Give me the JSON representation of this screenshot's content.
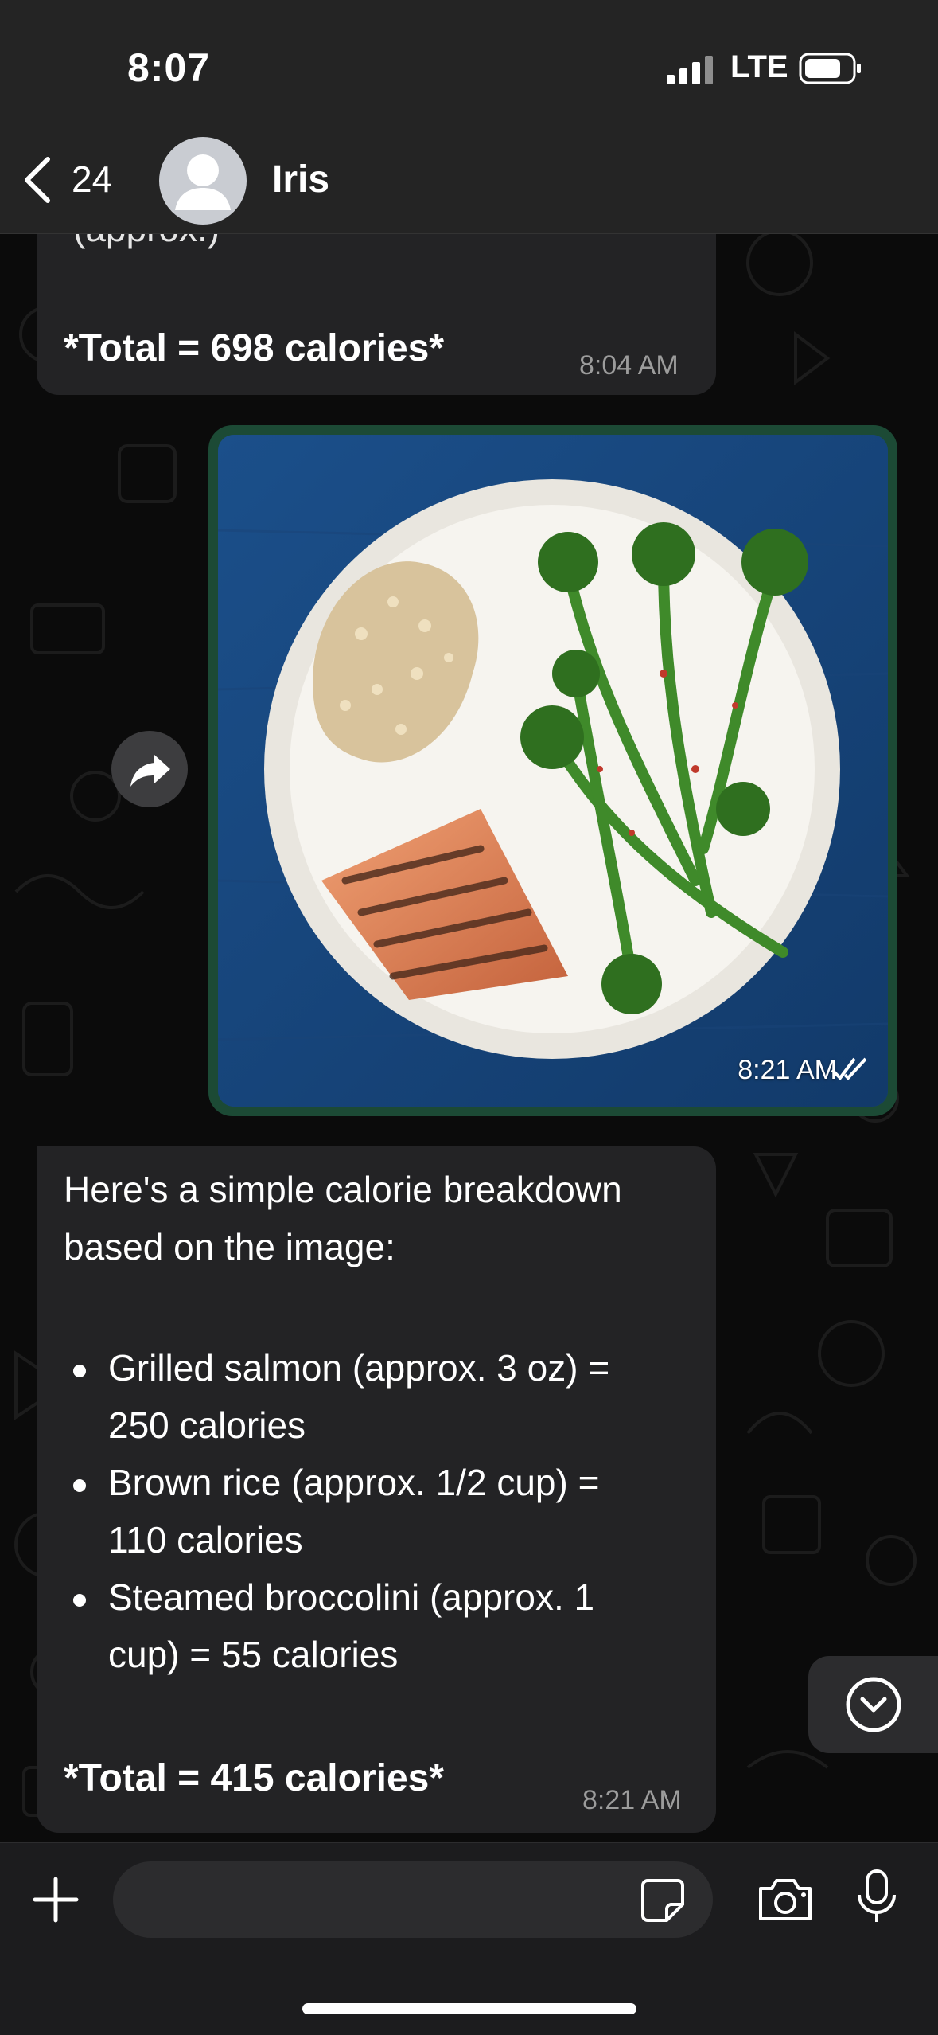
{
  "status_bar": {
    "time": "8:07",
    "network": "LTE"
  },
  "header": {
    "back_count": "24",
    "contact_name": "Iris"
  },
  "messages": {
    "first": {
      "cut_line": "(approx.)",
      "total": "*Total = 698 calories*",
      "time": "8:04 AM"
    },
    "image": {
      "time": "8:21 AM"
    },
    "second": {
      "intro_line1": "Here's a simple calorie breakdown",
      "intro_line2": "based on the image:",
      "items": [
        {
          "line1": "Grilled salmon (approx. 3 oz) =",
          "line2": "250 calories"
        },
        {
          "line1": "Brown rice (approx. 1/2 cup) =",
          "line2": "110 calories"
        },
        {
          "line1": "Steamed broccolini (approx. 1",
          "line2": "cup) = 55 calories"
        }
      ],
      "total": "*Total = 415 calories*",
      "time": "8:21 AM"
    }
  },
  "composer": {
    "placeholder": ""
  },
  "icons": {
    "back": "chevron-left-icon",
    "forward": "forward-arrow-icon",
    "scroll": "chevron-down-circle-icon",
    "plus": "plus-icon",
    "sticker": "sticker-icon",
    "camera": "camera-icon",
    "mic": "microphone-icon",
    "read_receipt": "double-check-icon"
  },
  "colors": {
    "header_bg": "#242424",
    "bubble_in": "#232325",
    "image_bubble_border": "#1c4a35",
    "composer_bg": "#1c1c1e"
  }
}
